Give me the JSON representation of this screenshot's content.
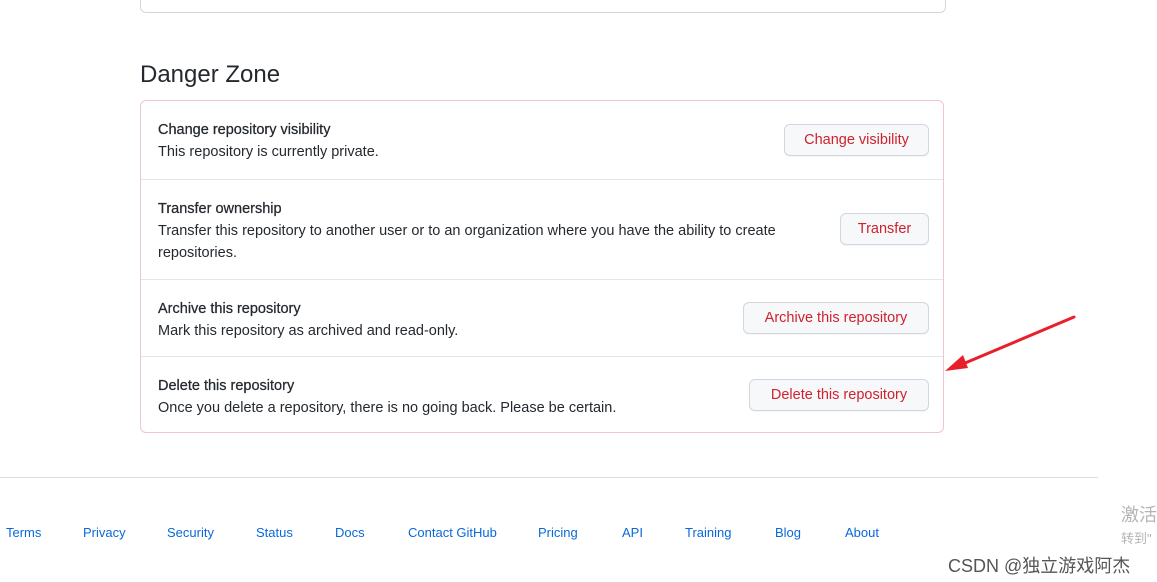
{
  "danger_zone": {
    "title": "Danger Zone",
    "rows": [
      {
        "title": "Change repository visibility",
        "description": "This repository is currently private.",
        "button": "Change visibility"
      },
      {
        "title": "Transfer ownership",
        "description_line1": "Transfer this repository to another user or to an organization where you have the ability to create",
        "description_line2": "repositories.",
        "button": "Transfer"
      },
      {
        "title": "Archive this repository",
        "description": "Mark this repository as archived and read-only.",
        "button": "Archive this repository"
      },
      {
        "title": "Delete this repository",
        "description": "Once you delete a repository, there is no going back. Please be certain.",
        "button": "Delete this repository"
      }
    ]
  },
  "footer": {
    "links": [
      "Terms",
      "Privacy",
      "Security",
      "Status",
      "Docs",
      "Contact GitHub",
      "Pricing",
      "API",
      "Training",
      "Blog",
      "About"
    ]
  },
  "overlay": {
    "activation_line1": "激活",
    "activation_line2": "转到\"",
    "watermark": "CSDN @独立游戏阿杰",
    "arrow_color": "#e8202a"
  },
  "colors": {
    "danger_text": "#cf222e",
    "link": "#0969da",
    "danger_border": "#f0c6cc"
  }
}
